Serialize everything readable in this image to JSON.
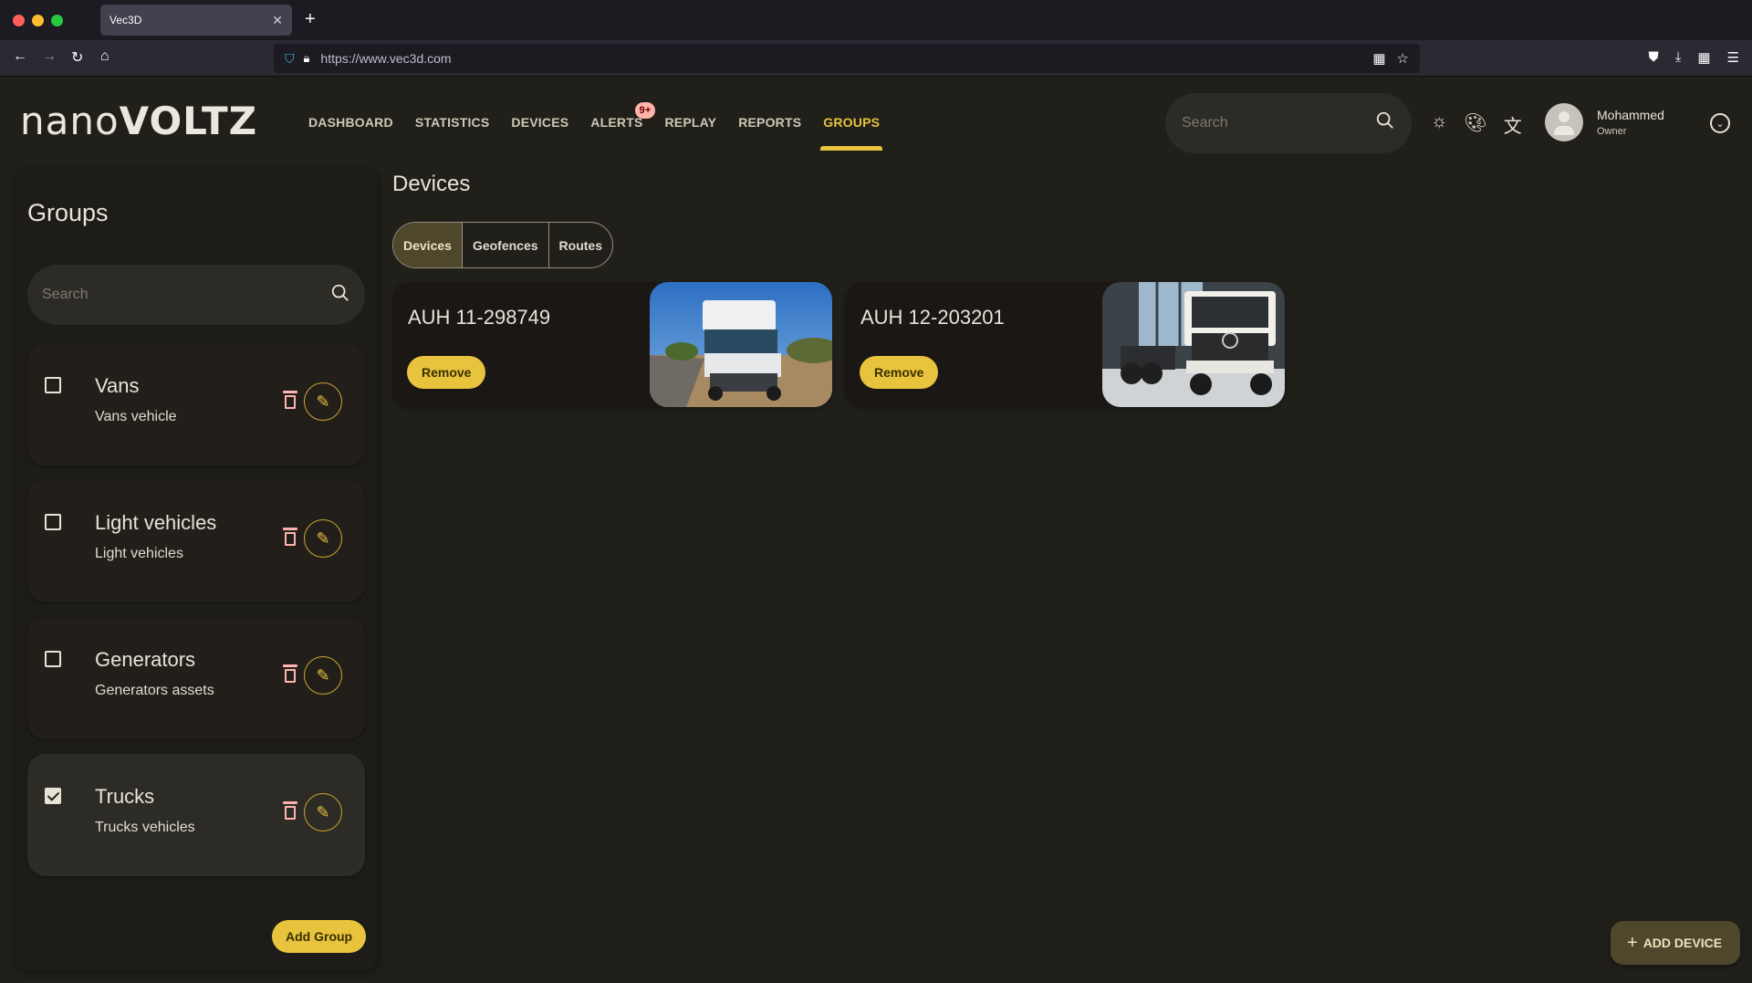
{
  "browser": {
    "tab_title": "Vec3D",
    "url": "https://www.vec3d.com"
  },
  "header": {
    "logo_prefix": "nano",
    "logo_suffix": "VOLTZ",
    "nav": [
      {
        "label": "DASHBOARD",
        "active": false
      },
      {
        "label": "STATISTICS",
        "active": false
      },
      {
        "label": "DEVICES",
        "active": false
      },
      {
        "label": "ALERTS",
        "active": false,
        "badge": "9+"
      },
      {
        "label": "REPLAY",
        "active": false
      },
      {
        "label": "REPORTS",
        "active": false
      },
      {
        "label": "GROUPS",
        "active": true
      }
    ],
    "search_placeholder": "Search",
    "icons": [
      "brightness-icon",
      "palette-icon",
      "translate-icon"
    ],
    "user": {
      "name": "Mohammed",
      "role": "Owner"
    }
  },
  "sidebar": {
    "title": "Groups",
    "search_placeholder": "Search",
    "groups": [
      {
        "name": "Vans",
        "description": "Vans vehicle",
        "checked": false
      },
      {
        "name": "Light vehicles",
        "description": "Light vehicles",
        "checked": false
      },
      {
        "name": "Generators",
        "description": "Generators assets",
        "checked": false
      },
      {
        "name": "Trucks",
        "description": "Trucks vehicles",
        "checked": true
      }
    ],
    "add_group_label": "Add Group"
  },
  "main": {
    "title": "Devices",
    "tabs": [
      {
        "label": "Devices",
        "active": true
      },
      {
        "label": "Geofences",
        "active": false
      },
      {
        "label": "Routes",
        "active": false
      }
    ],
    "devices": [
      {
        "name": "AUH 11-298749",
        "remove_label": "Remove",
        "image": "white cab-over truck tractor on a road under blue sky"
      },
      {
        "name": "AUH 12-203201",
        "remove_label": "Remove",
        "image": "white Hino chassis truck in a showroom"
      }
    ],
    "add_device_label": "ADD DEVICE"
  },
  "colors": {
    "accent": "#e8c33e",
    "background": "#211f1a",
    "danger": "#ffb4ab",
    "active_segment": "#4f472b"
  }
}
